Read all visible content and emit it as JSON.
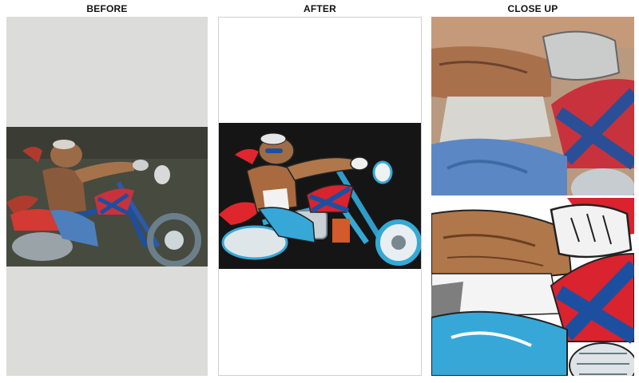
{
  "headings": {
    "before": "BEFORE",
    "after": "AFTER",
    "close_up": "CLOSE UP"
  },
  "images": {
    "before": "hog-biker-photo-original",
    "after": "hog-biker-vector-redraw",
    "close_up_original": "hog-biker-arm-detail-original",
    "close_up_vector": "hog-biker-arm-detail-vector"
  },
  "colors": {
    "panel_gray": "#dcdcda",
    "after_background": "#151515",
    "bike_blue": "#35a9d6",
    "flag_red": "#d9232e",
    "flag_blue": "#1d4fa0",
    "skin": "#a86a3e"
  }
}
